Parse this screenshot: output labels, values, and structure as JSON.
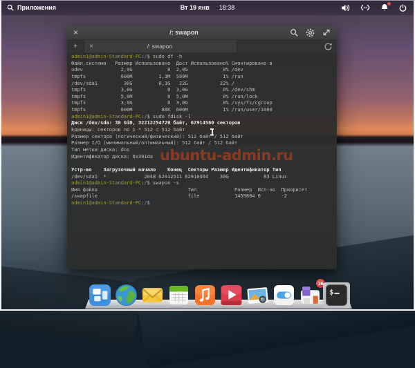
{
  "panel": {
    "app_menu": "Приложения",
    "date": "Вт 19 янв",
    "time": "18:38"
  },
  "window": {
    "title": "/: swapon",
    "tab_title": "/: swapon"
  },
  "glyphs": {
    "close": "×",
    "tab_close": "×",
    "new_tab": "+"
  },
  "terminal": {
    "lines": [
      [
        {
          "c": "u",
          "t": "admin1@admin-Standard-PC"
        },
        {
          "c": "t",
          "t": ":"
        },
        {
          "c": "p",
          "t": "/"
        },
        {
          "c": "t",
          "t": "$ sudo df -h"
        }
      ],
      [
        {
          "c": "t",
          "t": "Файл.система   Размер Использовано  Дост Использовано% Смонтировано в"
        }
      ],
      [
        {
          "c": "t",
          "t": "udev             2,9G            0  2,9G            0% /dev"
        }
      ],
      [
        {
          "c": "t",
          "t": "tmpfs            600M         1,3M  599M            1% /run"
        }
      ],
      [
        {
          "c": "t",
          "t": "/dev/sda1         30G         6,1G   22G           22% /"
        }
      ],
      [
        {
          "c": "t",
          "t": "tmpfs            3,0G            0  3,0G            0% /dev/shm"
        }
      ],
      [
        {
          "c": "t",
          "t": "tmpfs            5,0M            0  5,0M            0% /run/lock"
        }
      ],
      [
        {
          "c": "t",
          "t": "tmpfs            3,0G            0  3,0G            0% /sys/fs/cgroup"
        }
      ],
      [
        {
          "c": "t",
          "t": "tmpfs            600M          88K  600M            1% /run/user/1000"
        }
      ],
      [
        {
          "c": "u",
          "t": "admin1@admin-Standard-PC"
        },
        {
          "c": "t",
          "t": ":"
        },
        {
          "c": "p",
          "t": "/"
        },
        {
          "c": "t",
          "t": "$ sudo fdisk -l"
        }
      ],
      [
        {
          "c": "b",
          "t": "Диск /dev/sda: 30 GiB, 32212254720 байт, 62914560 секторов"
        }
      ],
      [
        {
          "c": "t",
          "t": "Единицы: секторов по 1 * 512 = 512 байт"
        }
      ],
      [
        {
          "c": "t",
          "t": "Размер сектора (логический/физический): 512 байт / 512 байт"
        }
      ],
      [
        {
          "c": "t",
          "t": "Размер I/O (минимальный/оптимальный): 512 байт / 512 байт"
        }
      ],
      [
        {
          "c": "t",
          "t": "Тип метки диска: dos"
        }
      ],
      [
        {
          "c": "t",
          "t": "Идентификатор диска: 0x391da"
        }
      ],
      [],
      [
        {
          "c": "b",
          "t": "Устр-во    Загрузочный начало    Конец  Секторы Размер Идентификатор Тип"
        }
      ],
      [
        {
          "c": "t",
          "t": "/dev/sda1  *             2048 62912511 62910464    30G            83 Linux"
        }
      ],
      [
        {
          "c": "u",
          "t": "admin1@admin-Standard-PC"
        },
        {
          "c": "t",
          "t": ":"
        },
        {
          "c": "p",
          "t": "/"
        },
        {
          "c": "t",
          "t": "$ swapon -s"
        }
      ],
      [
        {
          "c": "t",
          "t": "Имя файла                               Тип             Размер  Исп-но  Приоритет"
        }
      ],
      [
        {
          "c": "t",
          "t": "/swapfile                               file            1459804 0       -2"
        }
      ],
      [
        {
          "c": "u",
          "t": "admin1@admin-Standard-PC"
        },
        {
          "c": "t",
          "t": ":"
        },
        {
          "c": "p",
          "t": "/"
        },
        {
          "c": "t",
          "t": "$"
        }
      ]
    ]
  },
  "watermark": {
    "text": "ubuntu-admin.ru",
    "color": "#8a3a22"
  },
  "dock": {
    "items": [
      "multitasking",
      "browser",
      "mail",
      "calendar",
      "music",
      "videos",
      "photos",
      "settings",
      "appcenter",
      "terminal"
    ],
    "appcenter_badge": "16",
    "active_item": "terminal"
  },
  "colors": {
    "prompt_user": "#9b9d2e",
    "prompt_path": "#5691d8",
    "terminal_text": "#bdbdbd",
    "terminal_bold": "#ececec",
    "terminal_bg": "#2d2d2d",
    "accent_red_badge": "#d7263d"
  }
}
